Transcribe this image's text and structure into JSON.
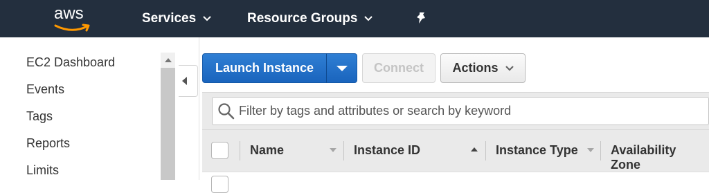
{
  "topnav": {
    "logo_text": "aws",
    "services_label": "Services",
    "resource_groups_label": "Resource Groups",
    "background": "#232f3e",
    "smile_color": "#ff9900"
  },
  "sidebar": {
    "items": [
      {
        "label": "EC2 Dashboard"
      },
      {
        "label": "Events"
      },
      {
        "label": "Tags"
      },
      {
        "label": "Reports"
      },
      {
        "label": "Limits"
      }
    ]
  },
  "toolbar": {
    "launch_label": "Launch Instance",
    "connect_label": "Connect",
    "actions_label": "Actions",
    "primary_color": "#1a64bd"
  },
  "filter": {
    "placeholder": "Filter by tags and attributes or search by keyword"
  },
  "table": {
    "columns": [
      {
        "label": "Name"
      },
      {
        "label": "Instance ID"
      },
      {
        "label": "Instance Type"
      },
      {
        "label": "Availability Zone"
      }
    ]
  }
}
